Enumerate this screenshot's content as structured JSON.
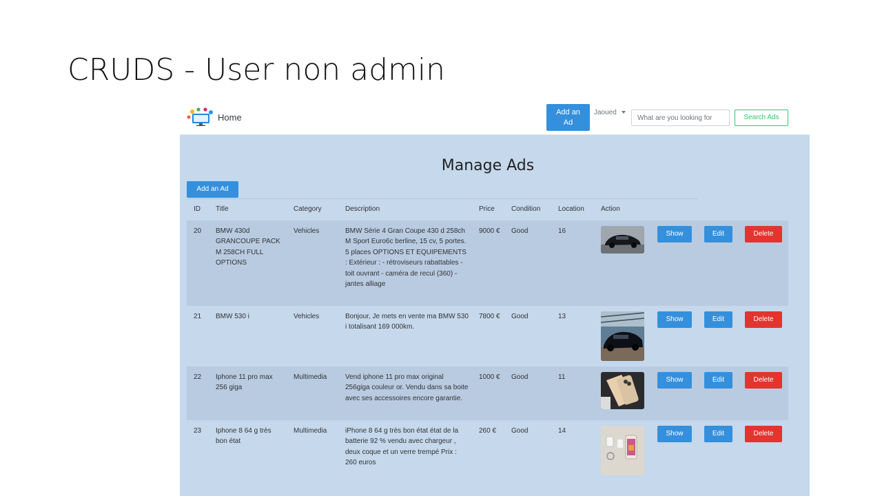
{
  "slide": {
    "title": "CRUDS - User non admin"
  },
  "navbar": {
    "brand": "Home",
    "add_ad_line1": "Add an",
    "add_ad_line2": "Ad",
    "user": "Jaoued",
    "search_placeholder": "What are you looking for",
    "search_button": "Search Ads"
  },
  "page": {
    "heading": "Manage Ads",
    "add_button": "Add an Ad"
  },
  "table": {
    "headers": [
      "ID",
      "Title",
      "Category",
      "Description",
      "Price",
      "Condition",
      "Location",
      "Action"
    ],
    "rows": [
      {
        "id": "20",
        "title": "BMW 430d GRANCOUPE PACK M 258CH FULL OPTIONS",
        "category": "Vehicles",
        "description": "BMW Série 4 Gran Coupe 430 d 258ch M Sport Euro6c berline, 15 cv, 5 portes. 5 places OPTIONS ET EQUIPEMENTS : Extérieur : - rétroviseurs rabattables - toit ouvrant - caméra de recul (360) - jantes alliage",
        "price": "9000 €",
        "condition": "Good",
        "location": "16"
      },
      {
        "id": "21",
        "title": "BMW 530 i",
        "category": "Vehicles",
        "description": "Bonjour, Je mets en vente ma BMW 530 i totalisant 169 000km.",
        "price": "7800 €",
        "condition": "Good",
        "location": "13"
      },
      {
        "id": "22",
        "title": "Iphone 11 pro max 256 giga",
        "category": "Multimedia",
        "description": "Vend iphone 11 pro max original 256giga couleur or. Vendu dans sa boite avec ses accessoires encore garantie.",
        "price": "1000 €",
        "condition": "Good",
        "location": "11"
      },
      {
        "id": "23",
        "title": "Iphone 8 64 g très bon état",
        "category": "Multimedia",
        "description": "iPhone 8 64 g très bon état état de la batterie 92 % vendu avec chargeur , deux coque et un verre trempé Prix : 260 euros",
        "price": "260 €",
        "condition": "Good",
        "location": "14"
      }
    ],
    "actions": {
      "show": "Show",
      "edit": "Edit",
      "delete": "Delete"
    }
  },
  "colors": {
    "primary": "#3490dc",
    "danger": "#e3342f",
    "success": "#38c172",
    "page_bg": "#c5d8ec",
    "row_alt": "#b8cbe1"
  }
}
